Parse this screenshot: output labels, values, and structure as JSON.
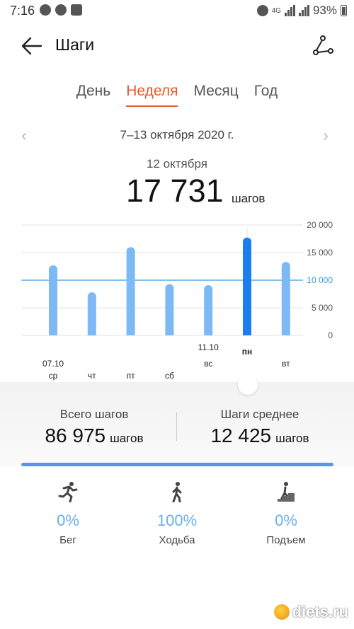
{
  "status_bar": {
    "time": "7:16",
    "battery": "93%",
    "network": "4G"
  },
  "header": {
    "title": "Шаги"
  },
  "tabs": [
    {
      "label": "День",
      "active": false
    },
    {
      "label": "Неделя",
      "active": true
    },
    {
      "label": "Месяц",
      "active": false
    },
    {
      "label": "Год",
      "active": false
    }
  ],
  "range": {
    "label": "7–13 октября 2020 г."
  },
  "selected": {
    "date": "12 октября",
    "value": "17 731",
    "unit": "шагов"
  },
  "chart_data": {
    "type": "bar",
    "categories": [
      "ср",
      "чт",
      "пт",
      "сб",
      "вс",
      "пн",
      "вт"
    ],
    "date_labels": [
      "07.10",
      "",
      "",
      "",
      "11.10",
      "",
      ""
    ],
    "values": [
      12700,
      7800,
      16000,
      9300,
      9100,
      17731,
      13300
    ],
    "selected_index": 5,
    "ylim": [
      0,
      20000
    ],
    "yticks": [
      "20 000",
      "15 000",
      "10 000",
      "5 000",
      "0"
    ],
    "ytick_values": [
      20000,
      15000,
      10000,
      5000,
      0
    ],
    "goal_line": 10000,
    "goal_label": "10 000",
    "colors": {
      "bar": "#7db9f4",
      "selected": "#1a7ef0",
      "goal": "#3d9bd8"
    }
  },
  "summary": {
    "total_label": "Всего шагов",
    "total_value": "86 975",
    "total_unit": "шагов",
    "avg_label": "Шаги среднее",
    "avg_value": "12 425",
    "avg_unit": "шагов"
  },
  "activities": [
    {
      "pct": "0%",
      "label": "Бег",
      "icon": "running-icon"
    },
    {
      "pct": "100%",
      "label": "Ходьба",
      "icon": "walking-icon"
    },
    {
      "pct": "0%",
      "label": "Подъем",
      "icon": "climbing-icon"
    }
  ],
  "watermark": {
    "text": "diets.ru"
  }
}
